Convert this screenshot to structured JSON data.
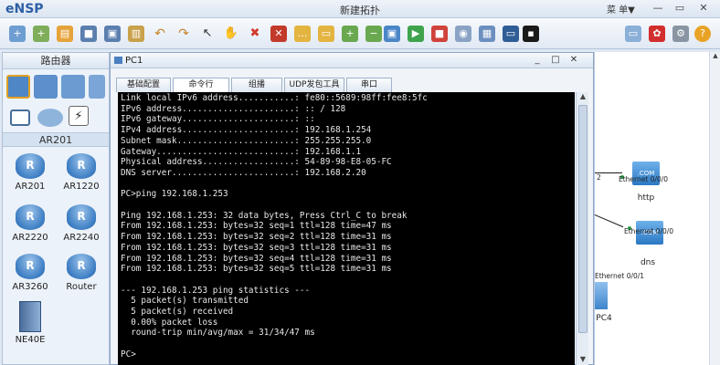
{
  "app": {
    "logo": "eNSP",
    "window_title": "新建拓扑",
    "menu_label": "菜 单▼"
  },
  "toolbar": {
    "icons": [
      "new-file-icon",
      "new-topology-icon",
      "open-icon",
      "save-icon",
      "save-as-icon",
      "print-icon",
      "undo-icon",
      "redo-icon",
      "select-icon",
      "hand-icon",
      "delete-icon",
      "delete-link-icon",
      "text-icon",
      "rectangle-icon",
      "zoom-in-icon",
      "zoom-out-icon",
      "fit-icon",
      "start-icon",
      "stop-icon",
      "capture-icon",
      "grid-icon",
      "topology-icon",
      "chat-icon",
      "huawei-icon",
      "settings-icon",
      "help-icon"
    ]
  },
  "left_panel": {
    "title": "路由器",
    "section": "AR201",
    "devices": [
      "AR201",
      "AR1220",
      "AR2220",
      "AR2240",
      "AR3260",
      "Router",
      "NE40E"
    ]
  },
  "pc_window": {
    "title": "PC1",
    "tabs": [
      "基础配置",
      "命令行",
      "组播",
      "UDP发包工具",
      "串口"
    ],
    "active_tab": "命令行",
    "terminal_lines": [
      "Link local IPv6 address...........: fe80::5689:98ff:fee8:5fc",
      "IPv6 address......................: :: / 128",
      "IPv6 gateway......................: ::",
      "IPv4 address......................: 192.168.1.254",
      "Subnet mask.......................: 255.255.255.0",
      "Gateway...........................: 192.168.1.1",
      "Physical address..................: 54-89-98-E8-05-FC",
      "DNS server........................: 192.168.2.20",
      "",
      "PC>ping 192.168.1.253",
      "",
      "Ping 192.168.1.253: 32 data bytes, Press Ctrl_C to break",
      "From 192.168.1.253: bytes=32 seq=1 ttl=128 time=47 ms",
      "From 192.168.1.253: bytes=32 seq=2 ttl=128 time=31 ms",
      "From 192.168.1.253: bytes=32 seq=3 ttl=128 time=31 ms",
      "From 192.168.1.253: bytes=32 seq=4 ttl=128 time=31 ms",
      "From 192.168.1.253: bytes=32 seq=5 ttl=128 time=31 ms",
      "",
      "--- 192.168.1.253 ping statistics ---",
      "  5 packet(s) transmitted",
      "  5 packet(s) received",
      "  0.00% packet loss",
      "  round-trip min/avg/max = 31/34/47 ms",
      "",
      "PC>"
    ]
  },
  "canvas": {
    "nodes": [
      {
        "label": "http",
        "port": "Ethernet 0/0/0",
        "icon_text": ".COM"
      },
      {
        "label": "dns",
        "port": "Ethernet 0/0/0",
        "icon_text": ".COM"
      },
      {
        "label": "PC4",
        "port": "Ethernet 0/0/1"
      }
    ],
    "edge_label": "2"
  },
  "colors": {
    "accent": "#2d5fa6",
    "terminal_bg": "#000000",
    "terminal_fg": "#e8e8e8",
    "link_dot": "#2ca24a"
  }
}
